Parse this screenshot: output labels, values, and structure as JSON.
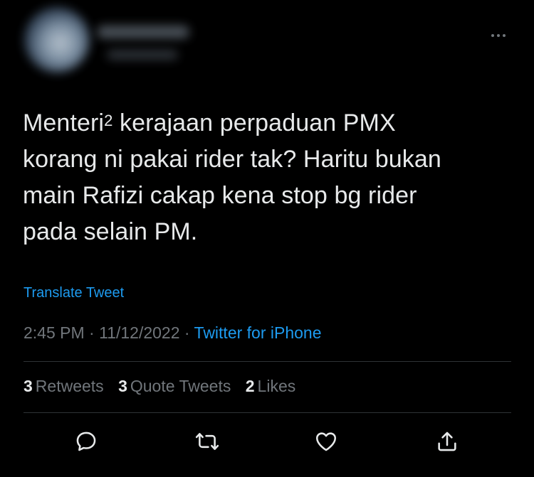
{
  "tweet": {
    "text": {
      "line1_before": "Menteri",
      "line1_sup": "2",
      "line1_after": " kerajaan perpaduan PMX",
      "line2": "korang ni pakai rider tak? Haritu bukan",
      "line3": "main Rafizi cakap kena stop bg rider",
      "line4": "pada selain PM."
    },
    "translate_label": "Translate Tweet",
    "meta": {
      "time": "2:45 PM",
      "sep1": " · ",
      "date": "11/12/2022",
      "sep2": " · ",
      "source": "Twitter for iPhone"
    },
    "stats": {
      "retweets_count": "3",
      "retweets_label": "Retweets",
      "quotes_count": "3",
      "quotes_label": "Quote Tweets",
      "likes_count": "2",
      "likes_label": "Likes"
    }
  },
  "icons": {
    "reply": "reply-icon",
    "retweet": "retweet-icon",
    "like": "heart-icon",
    "share": "share-icon",
    "more": "more-options-icon"
  },
  "colors": {
    "background": "#000000",
    "text": "#e7e9ea",
    "secondary": "#71767b",
    "accent": "#1d9bf0",
    "divider": "#2f3336"
  }
}
